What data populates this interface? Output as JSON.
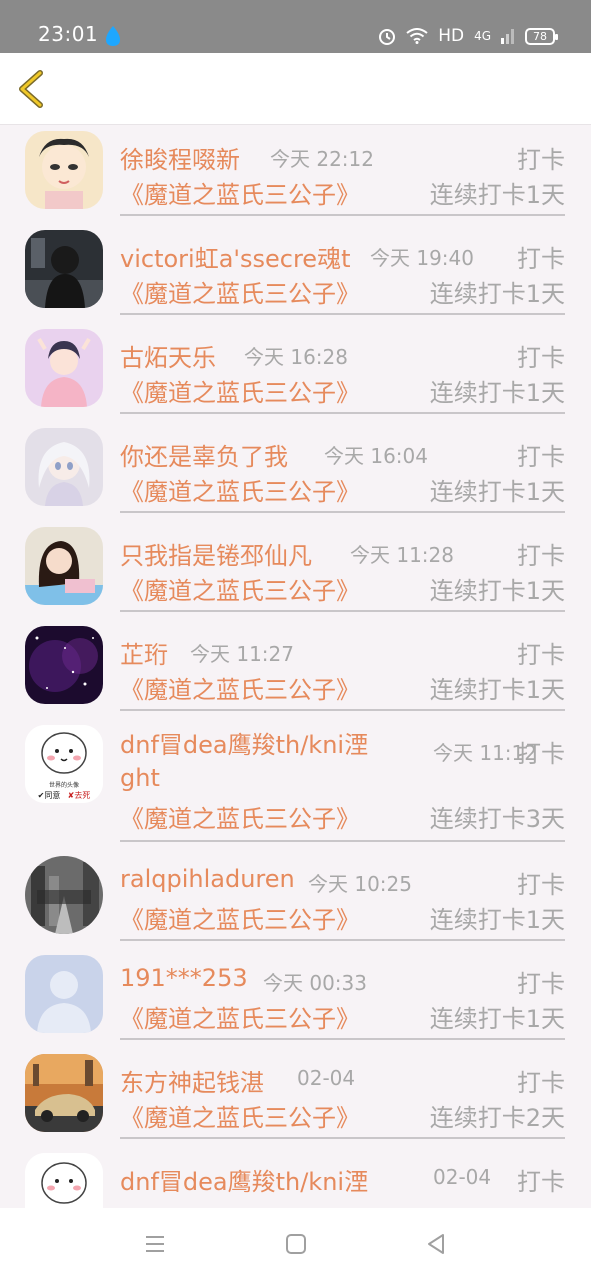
{
  "status_bar": {
    "time": "23:01",
    "network": "HD",
    "signal": "4G",
    "battery": "78"
  },
  "header": {
    "back_icon": "back-chevron-icon"
  },
  "list": [
    {
      "name": "徐睃程啜新",
      "time": "今天 22:12",
      "action": "打卡",
      "book": "《魔道之蓝氏三公子》",
      "streak": "连续打卡1天"
    },
    {
      "name": "victori虹a'ssecre魂t",
      "time": "今天 19:40",
      "action": "打卡",
      "book": "《魔道之蓝氏三公子》",
      "streak": "连续打卡1天"
    },
    {
      "name": "古炻天乐",
      "time": "今天 16:28",
      "action": "打卡",
      "book": "《魔道之蓝氏三公子》",
      "streak": "连续打卡1天"
    },
    {
      "name": "你还是辜负了我",
      "time": "今天 16:04",
      "action": "打卡",
      "book": "《魔道之蓝氏三公子》",
      "streak": "连续打卡1天"
    },
    {
      "name": "只我指是锩邳仙凡",
      "time": "今天 11:28",
      "action": "打卡",
      "book": "《魔道之蓝氏三公子》",
      "streak": "连续打卡1天"
    },
    {
      "name": "芷珩",
      "time": "今天 11:27",
      "action": "打卡",
      "book": "《魔道之蓝氏三公子》",
      "streak": "连续打卡1天"
    },
    {
      "name": "dnf冒dea鹰羧th/kni湮ght",
      "time": "今天 11:12",
      "action": "打卡",
      "book": "《魔道之蓝氏三公子》",
      "streak": "连续打卡3天"
    },
    {
      "name": "ralqpihladuren",
      "time": "今天 10:25",
      "action": "打卡",
      "book": "《魔道之蓝氏三公子》",
      "streak": "连续打卡1天"
    },
    {
      "name": "191***253",
      "time": "今天 00:33",
      "action": "打卡",
      "book": "《魔道之蓝氏三公子》",
      "streak": "连续打卡1天"
    },
    {
      "name": "东方神起钱湛",
      "time": "02-04",
      "action": "打卡",
      "book": "《魔道之蓝氏三公子》",
      "streak": "连续打卡2天"
    },
    {
      "name": "dnf冒dea鹰羧th/kni湮",
      "time": "02-04",
      "action": "打卡",
      "book": "",
      "streak": ""
    }
  ],
  "avatar_captions": {
    "wenan": "世界的头像",
    "agree": "✔同意",
    "die": "✘去死"
  },
  "colors": {
    "accent": "#e68a5c",
    "muted": "#a8a8a8",
    "status_bar": "#8a8a8a"
  }
}
